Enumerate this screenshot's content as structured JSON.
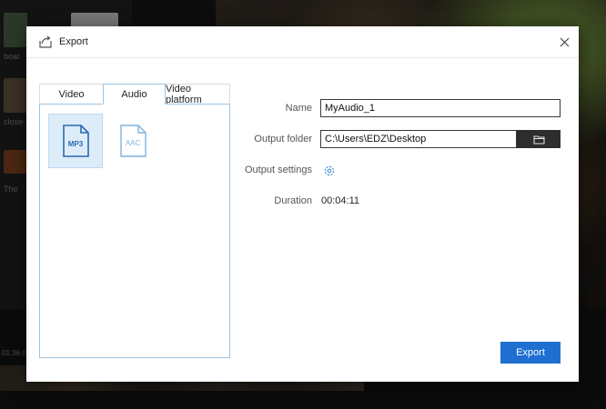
{
  "background": {
    "media_items": [
      "boat",
      "close-",
      "The"
    ],
    "timecode": "01:36.00"
  },
  "dialog": {
    "title": "Export",
    "title_icon": "export-arrow-icon",
    "close_icon": "close-icon",
    "tabs": [
      "Video",
      "Audio",
      "Video platform"
    ],
    "active_tab": "Audio",
    "formats": [
      {
        "label": "MP3",
        "selected": true
      },
      {
        "label": "AAC",
        "selected": false
      }
    ],
    "form": {
      "name_label": "Name",
      "name_value": "MyAudio_1",
      "output_folder_label": "Output folder",
      "output_folder_value": "C:\\Users\\EDZ\\Desktop",
      "output_settings_label": "Output settings",
      "duration_label": "Duration",
      "duration_value": "00:04:11"
    },
    "export_button": "Export",
    "colors": {
      "accent": "#1e6fd0",
      "selection": "#dcecf9",
      "panel_border": "#9dc5e4",
      "icon_blue": "#2a6ab3",
      "icon_light_blue": "#7fb4e0"
    }
  }
}
